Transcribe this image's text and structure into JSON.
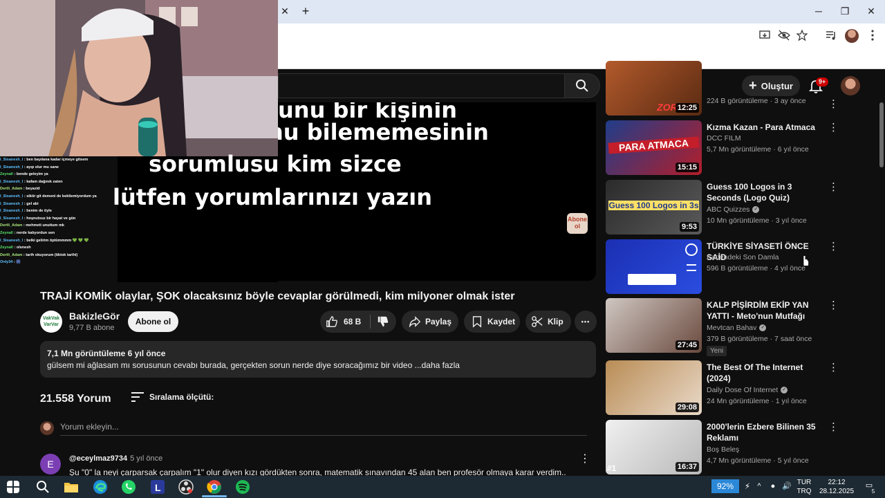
{
  "browser": {
    "tab_close": "✕",
    "new_tab": "+",
    "window_controls": [
      "─",
      "❐",
      "✕"
    ]
  },
  "header": {
    "create_label": "Oluştur",
    "notif_badge": "9+"
  },
  "player": {
    "subtitle_lines": [
      "unu bir kişinin",
      "nu bilememesinin",
      "sorumlusu kim sizce",
      "lütfen yorumlarınızı yazın"
    ],
    "logo_text": "Abone ol"
  },
  "chat": [
    {
      "user": "I_Sisanesh_I",
      "msg": "ben bayılana kadar içmeye gitsem",
      "cls": "u1"
    },
    {
      "user": "I_Sisanesh_I",
      "msg": "ayıp olur mu sane",
      "cls": "u1"
    },
    {
      "user": "Zeynall",
      "msg": "bende geleyim ya",
      "cls": "u2"
    },
    {
      "user": "I_Sisanesh_I",
      "msg": "kafam dağınık zaten",
      "cls": "u1"
    },
    {
      "user": "Dertli_Adam",
      "msg": "beyazid",
      "cls": "u3"
    },
    {
      "user": "I_Sisanesh_I",
      "msg": "siktir git demeni de bekliemiyordum ya",
      "cls": "u1"
    },
    {
      "user": "I_Sisanesh_I",
      "msg": "gel abi",
      "cls": "u1"
    },
    {
      "user": "I_Sisanesh_I",
      "msg": "benim de öyle",
      "cls": "u1"
    },
    {
      "user": "I_Sisanesh_I",
      "msg": "hoşnutsuz bir hayat ve gün",
      "cls": "u1"
    },
    {
      "user": "Dertli_Adam",
      "msg": "mehmeti unuttum mk",
      "cls": "u3"
    },
    {
      "user": "Zeynall",
      "msg": "nerde kalıyordun sen",
      "cls": "u2"
    },
    {
      "user": "I_Sisanesh_I",
      "msg": "belki gelirim öptümmmm 💚 💚 💚",
      "cls": "u1"
    },
    {
      "user": "Zeynall",
      "msg": "olsnesh",
      "cls": "u2"
    },
    {
      "user": "Dertli_Adam",
      "msg": "tarih okuyorum (tiktok tarihi)",
      "cls": "u3"
    },
    {
      "user": "Only34",
      "msg": "🎆",
      "cls": "u4"
    }
  ],
  "video": {
    "title": "TRAJİ KOMİK olaylar, ŞOK olacaksınız böyle cevaplar görülmedi, kim milyoner olmak ister",
    "channel_name": "BakizleGör",
    "channel_avatar_text": "VakVak VarVar",
    "subscribers": "9,77 B abone",
    "subscribe_label": "Abone ol",
    "likes": "68 B",
    "share_label": "Paylaş",
    "save_label": "Kaydet",
    "clip_label": "Klip",
    "more_label": "•••",
    "views_date": "7,1 Mn görüntüleme  6 yıl önce",
    "description": "gülsem mi ağlasam mı sorusunun cevabı burada, gerçekten sorun nerde diye soracağımız bir video ...daha fazla"
  },
  "comments": {
    "count_label": "21.558 Yorum",
    "sort_label": "Sıralama ölçütü:",
    "add_placeholder": "Yorum ekleyin...",
    "first": {
      "avatar_letter": "E",
      "user": "@eceylmaz9734",
      "time": "5 yıl önce",
      "text": "Şu \"0\" la neyi çarparsak çarpalım \"1\" olur diyen kızı gördükten sonra, matematik sınavından 45 alan ben profesör olmaya karar verdim.."
    }
  },
  "recommendations": [
    {
      "title": "",
      "channel": "",
      "meta": "224 B görüntüleme · 3 ay önce",
      "duration": "12:25",
      "thumb_text": "ZOR SI"
    },
    {
      "title": "Kızma Kazan - Para Atmaca",
      "channel": "DCC FILM",
      "meta": "5,7 Mn görüntüleme · 6 yıl önce",
      "duration": "15:15",
      "thumb_text": "PARA ATMACA"
    },
    {
      "title": "Guess 100 Logos in 3 Seconds (Logo Quiz)",
      "channel": "ABC Quizzes",
      "meta": "10 Mn görüntüleme · 3 yıl önce",
      "duration": "9:53",
      "thumb_text": "Guess 100 Logos in 3s"
    },
    {
      "title": "TÜRKİYE SİYASETİ ÖNCE SAİD",
      "channel": "Kadehdeki Son Damla",
      "meta": "596 B görüntüleme · 4 yıl önce",
      "duration": "",
      "thumb_text": ""
    },
    {
      "title": "KALP PİŞİRDİM EKİP YAN YATTI - Meto'nun Mutfağı",
      "channel": "Mevtcan Bahav",
      "meta": "379 B görüntüleme · 7 saat önce",
      "duration": "27:45",
      "badge": "Yeni"
    },
    {
      "title": "The Best Of The Internet (2024)",
      "channel": "Daily Dose Of Internet",
      "meta": "24 Mn görüntüleme · 1 yıl önce",
      "duration": "29:08"
    },
    {
      "title": "2000'lerin Ezbere Bilinen 35 Reklamı",
      "channel": "Boş Beleş",
      "meta": "4,7 Mn görüntüleme · 5 yıl önce",
      "duration": "16:37",
      "rank": "#1"
    }
  ],
  "taskbar": {
    "battery": "92%",
    "lang_line1": "TUR",
    "lang_line2": "TRQ",
    "time": "22:12",
    "date": "28.12.2025",
    "notif_count": "5"
  },
  "colors": {
    "bg": "#0f0f0f",
    "pill": "#272727",
    "accent_red": "#cc0000",
    "taskbar": "#1d2a33",
    "battery": "#2b88d8"
  }
}
